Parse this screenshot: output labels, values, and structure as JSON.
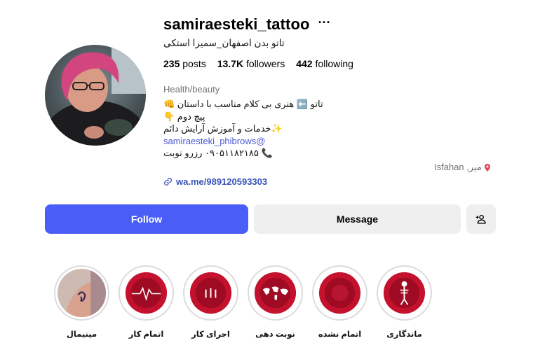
{
  "profile": {
    "username": "samiraesteki_tattoo",
    "more_glyph": "···",
    "full_name": "تاتو بدن اصفهان_سمیرا استکی",
    "category": "Health/beauty",
    "avatar_icon": "profile-photo"
  },
  "stats": {
    "posts_count": "235",
    "posts_label": "posts",
    "followers_count": "13.7K",
    "followers_label": "followers",
    "following_count": "442",
    "following_label": "following"
  },
  "bio": {
    "line1": "تاتو ⬅️ هنری بی کلام مناسب با داستان 👊",
    "line2": "پیچ دوم 👇",
    "line3": "✨خدمات و آموزش آرایش دائم",
    "mention": "samiraesteki_phibrows@",
    "line5": "📞 ۰۹۰۵۱۱۸۲۱۸۵ رزرو نوبت"
  },
  "location": {
    "text": "Isfahan ,میر",
    "icon": "pin-icon"
  },
  "link": {
    "text": "wa.me/989120593303",
    "icon": "link-icon"
  },
  "actions": {
    "follow_label": "Follow",
    "message_label": "Message",
    "add_user_icon": "add-user-icon"
  },
  "colors": {
    "follow_bg": "#4a5ef7",
    "secondary_bg": "#efefef",
    "link": "#3a54b8",
    "muted": "#737373",
    "highlight_red": "#c4122e"
  },
  "highlights": [
    {
      "label": "مینیمال"
    },
    {
      "label": "اتمام کار"
    },
    {
      "label": "اجرای کار"
    },
    {
      "label": "نوبت دهی"
    },
    {
      "label": "اتمام نشده"
    },
    {
      "label": "ماندگاری"
    }
  ]
}
